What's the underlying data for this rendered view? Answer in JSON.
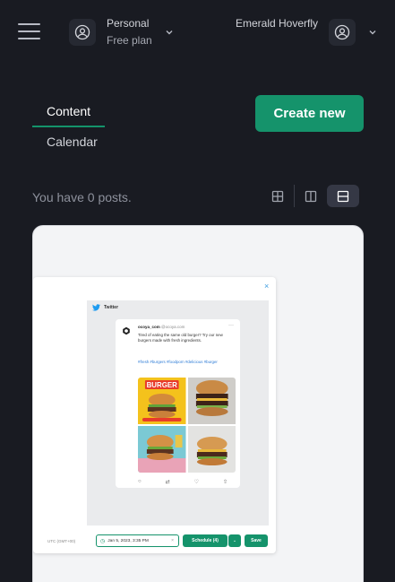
{
  "header": {
    "menu_icon": "hamburger-icon",
    "workspace": {
      "name": "Personal",
      "plan": "Free plan",
      "icon": "user-circle-icon"
    },
    "user": {
      "name": "Emerald Hoverfly",
      "icon": "user-circle-icon"
    }
  },
  "tabs": [
    {
      "label": "Content",
      "active": true
    },
    {
      "label": "Calendar",
      "active": false
    }
  ],
  "create_button": "Create new",
  "posts_summary": "You have 0 posts.",
  "view_modes": [
    {
      "icon": "grid-view-icon",
      "active": false
    },
    {
      "icon": "split-view-icon",
      "active": false
    },
    {
      "icon": "list-view-icon",
      "active": true
    }
  ],
  "preview": {
    "network": "Twitter",
    "close_glyph": "×",
    "tweet": {
      "account": "ocoya_com",
      "handle": "@ocoya.com",
      "text": "Tired of eating the same old burger? Try our new burgers made with fresh ingredients.",
      "hashtags": "#fresh #burgers #foodporn #delicious #burger",
      "image_banner_text": "BURGER"
    },
    "timezone": "UTC (GMT+00)",
    "scheduled_date": "Jan 5, 2023, 3:35 PM",
    "schedule_button": "Schedule (4)",
    "save_button": "Save"
  },
  "colors": {
    "background": "#191b22",
    "accent": "#15936b",
    "card": "#f3f4f6"
  }
}
